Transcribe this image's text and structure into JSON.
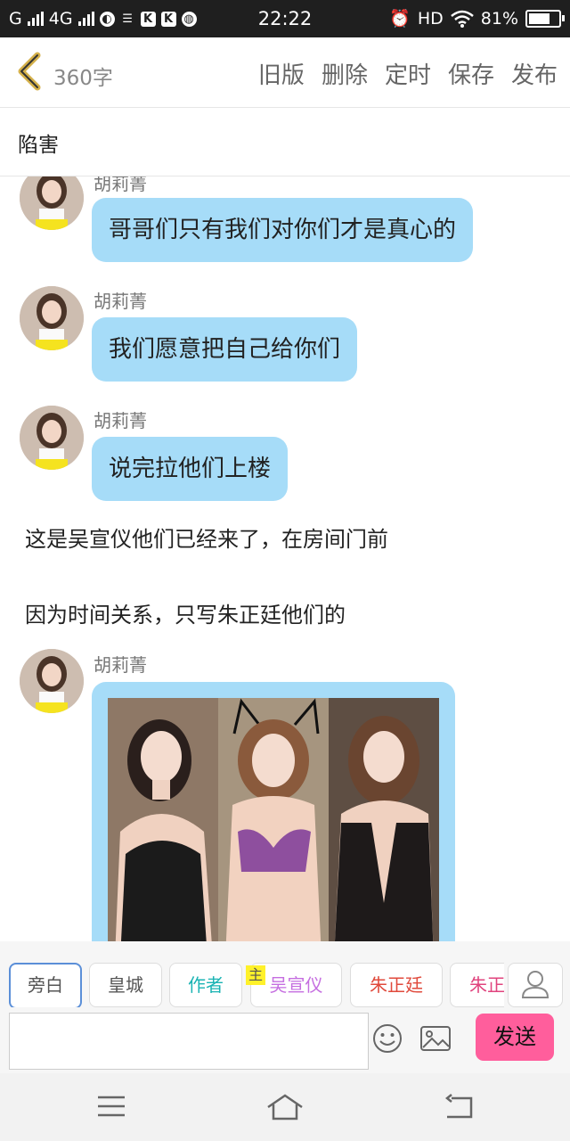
{
  "status_bar": {
    "carrier": "G",
    "network": "4G",
    "app_icons": [
      "K",
      "K"
    ],
    "time": "22:22",
    "hd": "HD",
    "battery_text": "81%",
    "battery_level": 0.81
  },
  "header": {
    "back_icon": "chevron-left-icon",
    "word_count": "360字",
    "actions": [
      "旧版",
      "删除",
      "定时",
      "保存",
      "发布"
    ]
  },
  "story_title": "陷害",
  "messages": [
    {
      "name": "胡莉菁",
      "text": "哥哥们只有我们对你们才是真心的"
    },
    {
      "name": "胡莉菁",
      "text": "我们愿意把自己给你们"
    },
    {
      "name": "胡莉菁",
      "text": "说完拉他们上楼"
    }
  ],
  "narration": [
    "这是吴宣仪他们已经来了，在房间门前",
    "因为时间关系，只写朱正廷他们的"
  ],
  "image_message": {
    "name": "胡莉菁"
  },
  "toolbar": {
    "characters": [
      {
        "label": "旁白",
        "color": "#555555"
      },
      {
        "label": "皇城",
        "color": "#555555"
      },
      {
        "label": "作者",
        "color": "#19b3b3"
      },
      {
        "label": "吴宣仪",
        "color": "#c56ee0"
      },
      {
        "label": "朱正廷",
        "color": "#e04a3c"
      },
      {
        "label": "朱正廷",
        "color": "#e0447e"
      }
    ],
    "protagonist_badge": "主",
    "input_placeholder": "",
    "send_label": "发送"
  },
  "colors": {
    "bubble": "#a6dcf8",
    "send_button": "#ff5e9c",
    "active_chip_border": "#5b8fd8"
  }
}
